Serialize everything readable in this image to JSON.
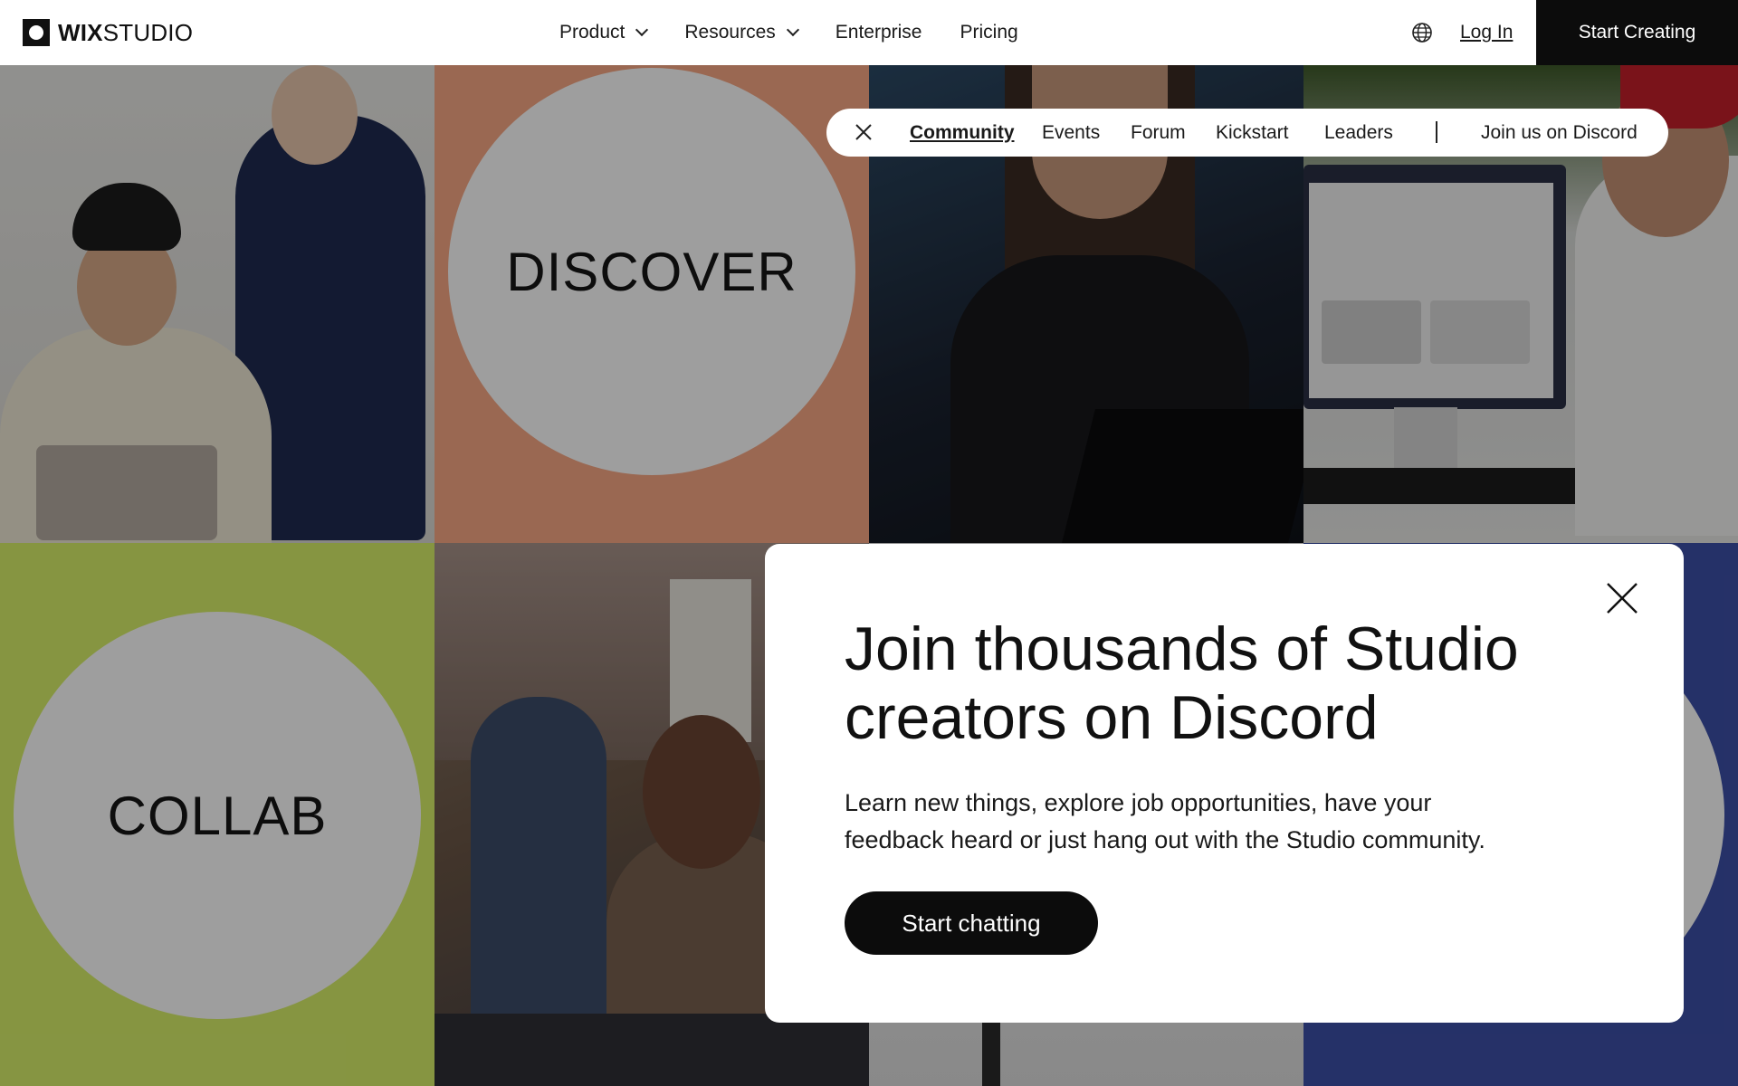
{
  "header": {
    "logo_bold": "WIX",
    "logo_light": "STUDIO",
    "nav": [
      {
        "label": "Product",
        "dropdown": true
      },
      {
        "label": "Resources",
        "dropdown": true
      },
      {
        "label": "Enterprise",
        "dropdown": false
      },
      {
        "label": "Pricing",
        "dropdown": false
      }
    ],
    "language_icon": "globe-icon",
    "login_label": "Log In",
    "cta_label": "Start Creating"
  },
  "subnav": {
    "close_icon": "close-icon",
    "links": [
      {
        "label": "Community",
        "active": true
      },
      {
        "label": "Events",
        "active": false
      },
      {
        "label": "Forum",
        "active": false
      },
      {
        "label": "Kickstart",
        "active": false
      },
      {
        "label": "Leaders",
        "active": false
      }
    ],
    "discord_label": "Join us on Discord"
  },
  "tiles": {
    "discover_label": "DISCOVER",
    "collab_label": "COLLAB"
  },
  "modal": {
    "title_line1": "Join thousands of Studio",
    "title_line2": "creators on Discord",
    "body_line1": "Learn new things, explore job opportunities, have your",
    "body_line2": "feedback heard or just hang out with the Studio community.",
    "cta_label": "Start chatting",
    "close_icon": "close-icon"
  },
  "colors": {
    "accent_black": "#0c0c0c",
    "peach": "#f9a985",
    "lime": "#d9f06a",
    "indigo": "#3d4fa8"
  }
}
